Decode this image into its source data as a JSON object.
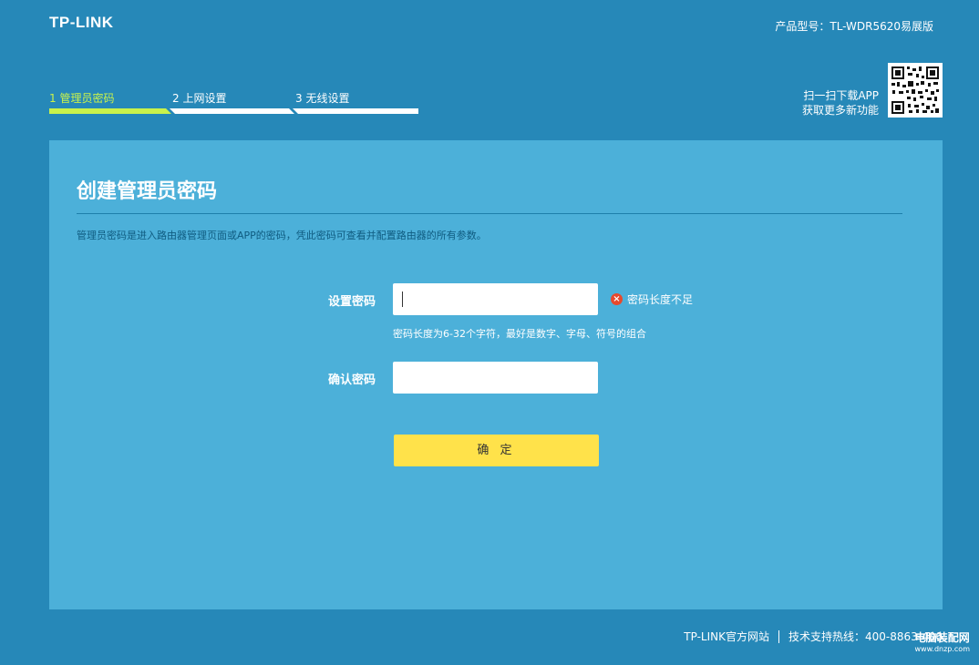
{
  "header": {
    "logo": "TP-LINK",
    "model": "产品型号：TL-WDR5620易展版"
  },
  "steps": [
    {
      "label": "1 管理员密码",
      "active": true
    },
    {
      "label": "2 上网设置",
      "active": false
    },
    {
      "label": "3 无线设置",
      "active": false
    }
  ],
  "colors": {
    "background": "#2688b8",
    "panel": "#4cb0d9",
    "active_step": "#c9f24b",
    "confirm_button": "#ffe24a",
    "error": "#e8492c"
  },
  "qr": {
    "line1": "扫一扫下载APP",
    "line2": "获取更多新功能",
    "icon": "qr-code-icon"
  },
  "panel": {
    "title": "创建管理员密码",
    "description": "管理员密码是进入路由器管理页面或APP的密码，凭此密码可查看并配置路由器的所有参数。",
    "password_label": "设置密码",
    "password_value": "",
    "error_text": "密码长度不足",
    "hint": "密码长度为6-32个字符，最好是数字、字母、符号的组合",
    "confirm_label": "确认密码",
    "confirm_value": "",
    "submit": "确 定"
  },
  "footer": {
    "site": "TP-LINK官方网站",
    "hotline": "技术支持热线：400-8863-400"
  },
  "watermark": {
    "line1": "电脑装配网",
    "line2": "www.dnzp.com"
  }
}
